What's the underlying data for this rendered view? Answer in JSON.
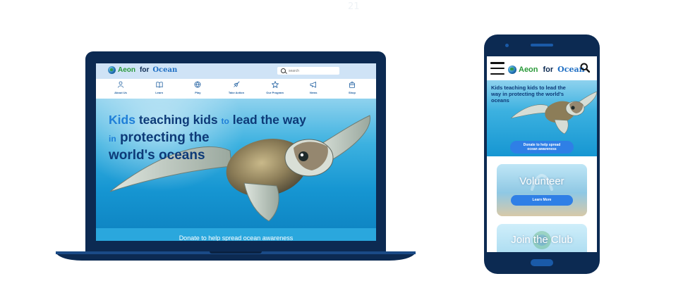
{
  "page_number": "21",
  "brand": {
    "aeon": "Aeon",
    "for": "for",
    "ocean": "Ocean"
  },
  "desktop": {
    "search": {
      "placeholder": "search"
    },
    "nav": [
      {
        "label": "About Us",
        "icon": "person-icon"
      },
      {
        "label": "Learn",
        "icon": "book-icon"
      },
      {
        "label": "Play",
        "icon": "ball-icon"
      },
      {
        "label": "Take Action",
        "icon": "rocket-icon"
      },
      {
        "label": "Our Program",
        "icon": "star-icon"
      },
      {
        "label": "News",
        "icon": "megaphone-icon"
      },
      {
        "label": "Shop",
        "icon": "bag-icon"
      }
    ],
    "hero": {
      "w1": "Kids",
      "w2": "teaching kids",
      "w3": "to",
      "w4": "lead the way",
      "w5": "in",
      "w6": "protecting the",
      "w7": "world's oceans"
    },
    "donate_text": "Donate to help spread ocean awareness"
  },
  "mobile": {
    "hero_text": "Kids teaching kids to lead the way in protecting the world's oceans",
    "donate_line1": "Donate to help spread",
    "donate_line2": "ocean awareness",
    "cards": {
      "volunteer": {
        "title": "Volunteer",
        "button": "Learn More"
      },
      "club": {
        "title": "Join the Club"
      }
    }
  },
  "colors": {
    "navy": "#0c2a52",
    "accent_blue": "#2f7fe6",
    "hero_text": "#0d3a78",
    "brand_green": "#2b9a3a"
  }
}
